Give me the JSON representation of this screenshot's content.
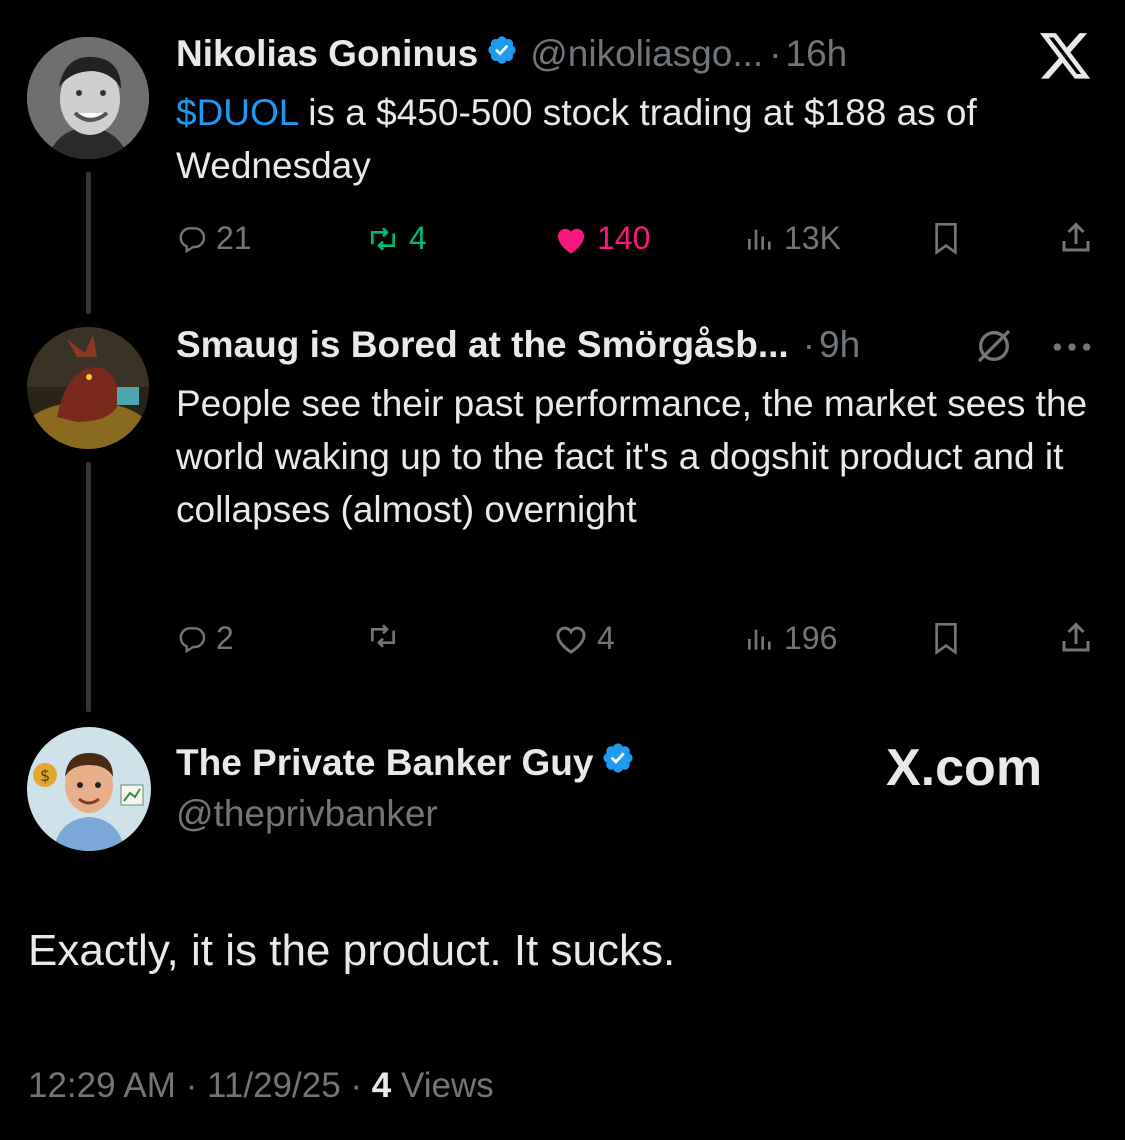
{
  "tweets": [
    {
      "author": "Nikolias Goninus",
      "handle": "@nikoliasgo...",
      "sep": "·",
      "time": "16h",
      "text_cashtag": "$DUOL",
      "text_rest": " is a $450-500 stock trading at $188 as of Wednesday",
      "replies": "21",
      "retweets": "4",
      "likes": "140",
      "views": "13K",
      "platform_icon": "x-logo-icon"
    },
    {
      "author": "Smaug is Bored at the Smörgåsb...",
      "sep": "·",
      "time": "9h",
      "text": "People see their past performance, the market sees the world waking up to the fact it's a dogshit product and it collapses (almost) overnight",
      "replies": "2",
      "retweets": "",
      "likes": "4",
      "views": "196"
    }
  ],
  "reply": {
    "author": "The Private Banker Guy",
    "handle": "@theprivbanker",
    "watermark": "X.com",
    "text": "Exactly, it is the product. It sucks.",
    "time": "12:29 AM",
    "date": "11/29/25",
    "sep": "·",
    "views_count": "4",
    "views_label": "Views"
  },
  "colors": {
    "background": "#000000",
    "text": "#e7e9ea",
    "muted": "#71767b",
    "link": "#1d9bf0",
    "retweet_active": "#00ba7c",
    "like_active": "#f91880",
    "verified": "#1d9bf0"
  }
}
